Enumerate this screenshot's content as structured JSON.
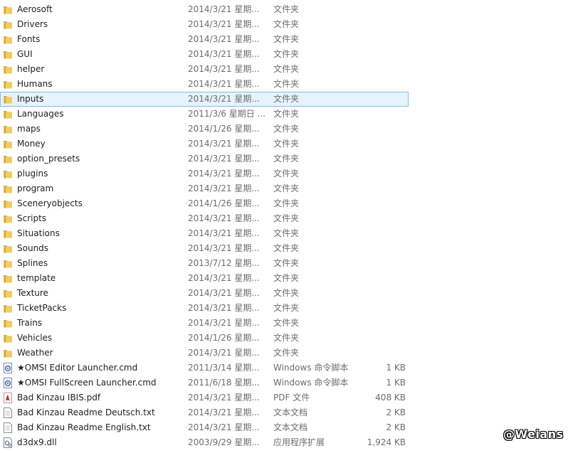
{
  "files": [
    {
      "name": "Aerosoft",
      "date": "2014/3/21 星期...",
      "type": "文件夹",
      "size": "",
      "icon": "folder-icon"
    },
    {
      "name": "Drivers",
      "date": "2014/3/21 星期...",
      "type": "文件夹",
      "size": "",
      "icon": "folder-icon"
    },
    {
      "name": "Fonts",
      "date": "2014/3/21 星期...",
      "type": "文件夹",
      "size": "",
      "icon": "folder-icon"
    },
    {
      "name": "GUI",
      "date": "2014/3/21 星期...",
      "type": "文件夹",
      "size": "",
      "icon": "folder-icon"
    },
    {
      "name": "helper",
      "date": "2014/3/21 星期...",
      "type": "文件夹",
      "size": "",
      "icon": "folder-icon"
    },
    {
      "name": "Humans",
      "date": "2014/3/21 星期...",
      "type": "文件夹",
      "size": "",
      "icon": "folder-icon"
    },
    {
      "name": "Inputs",
      "date": "2014/3/21 星期...",
      "type": "文件夹",
      "size": "",
      "icon": "folder-icon",
      "selected": true
    },
    {
      "name": "Languages",
      "date": "2011/3/6 星期日 ...",
      "type": "文件夹",
      "size": "",
      "icon": "folder-icon"
    },
    {
      "name": "maps",
      "date": "2014/1/26 星期...",
      "type": "文件夹",
      "size": "",
      "icon": "folder-icon"
    },
    {
      "name": "Money",
      "date": "2014/3/21 星期...",
      "type": "文件夹",
      "size": "",
      "icon": "folder-icon"
    },
    {
      "name": "option_presets",
      "date": "2014/3/21 星期...",
      "type": "文件夹",
      "size": "",
      "icon": "folder-icon"
    },
    {
      "name": "plugins",
      "date": "2014/3/21 星期...",
      "type": "文件夹",
      "size": "",
      "icon": "folder-icon"
    },
    {
      "name": "program",
      "date": "2014/3/21 星期...",
      "type": "文件夹",
      "size": "",
      "icon": "folder-icon"
    },
    {
      "name": "Sceneryobjects",
      "date": "2014/1/26 星期...",
      "type": "文件夹",
      "size": "",
      "icon": "folder-icon"
    },
    {
      "name": "Scripts",
      "date": "2014/3/21 星期...",
      "type": "文件夹",
      "size": "",
      "icon": "folder-icon"
    },
    {
      "name": "Situations",
      "date": "2014/3/21 星期...",
      "type": "文件夹",
      "size": "",
      "icon": "folder-icon"
    },
    {
      "name": "Sounds",
      "date": "2014/3/21 星期...",
      "type": "文件夹",
      "size": "",
      "icon": "folder-icon"
    },
    {
      "name": "Splines",
      "date": "2013/7/12 星期...",
      "type": "文件夹",
      "size": "",
      "icon": "folder-icon"
    },
    {
      "name": "template",
      "date": "2014/3/21 星期...",
      "type": "文件夹",
      "size": "",
      "icon": "folder-icon"
    },
    {
      "name": "Texture",
      "date": "2014/3/21 星期...",
      "type": "文件夹",
      "size": "",
      "icon": "folder-icon"
    },
    {
      "name": "TicketPacks",
      "date": "2014/3/21 星期...",
      "type": "文件夹",
      "size": "",
      "icon": "folder-icon"
    },
    {
      "name": "Trains",
      "date": "2014/3/21 星期...",
      "type": "文件夹",
      "size": "",
      "icon": "folder-icon"
    },
    {
      "name": "Vehicles",
      "date": "2014/1/26 星期...",
      "type": "文件夹",
      "size": "",
      "icon": "folder-icon"
    },
    {
      "name": "Weather",
      "date": "2014/3/21 星期...",
      "type": "文件夹",
      "size": "",
      "icon": "folder-icon"
    },
    {
      "name": "★OMSI Editor Launcher.cmd",
      "date": "2011/3/14 星期...",
      "type": "Windows 命令脚本",
      "size": "1 KB",
      "icon": "cmd-script-icon"
    },
    {
      "name": "★OMSI FullScreen Launcher.cmd",
      "date": "2011/6/18 星期...",
      "type": "Windows 命令脚本",
      "size": "1 KB",
      "icon": "cmd-script-icon"
    },
    {
      "name": "Bad Kinzau IBIS.pdf",
      "date": "2014/3/21 星期...",
      "type": "PDF 文件",
      "size": "408 KB",
      "icon": "pdf-icon"
    },
    {
      "name": "Bad Kinzau Readme Deutsch.txt",
      "date": "2014/3/21 星期...",
      "type": "文本文档",
      "size": "2 KB",
      "icon": "text-file-icon"
    },
    {
      "name": "Bad Kinzau Readme English.txt",
      "date": "2014/3/21 星期...",
      "type": "文本文档",
      "size": "2 KB",
      "icon": "text-file-icon"
    },
    {
      "name": "d3dx9.dll",
      "date": "2003/9/29 星期...",
      "type": "应用程序扩展",
      "size": "1,924 KB",
      "icon": "dll-file-icon"
    }
  ],
  "watermark": "@Weians",
  "colors": {
    "selection_bg": "#e5f3fb",
    "selection_border": "#7ec3e6",
    "folder": "#e8b84a"
  }
}
